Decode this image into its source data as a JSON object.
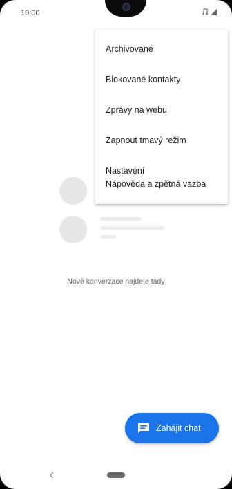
{
  "status_bar": {
    "time": "10:00",
    "icons": [
      "notification-icon",
      "signal-icon",
      "battery-icon"
    ]
  },
  "menu": {
    "items": [
      {
        "label": "Archivované"
      },
      {
        "label": "Blokované kontakty"
      },
      {
        "label": "Zprávy na webu"
      },
      {
        "label": "Zapnout tmavý režim"
      },
      {
        "label": "Nastavení"
      },
      {
        "label": "Nápověda a zpětná vazba"
      }
    ]
  },
  "empty_state": {
    "text": "Nové konverzace najdete tady"
  },
  "fab": {
    "label": "Zahájit chat",
    "icon": "chat-icon",
    "color": "#1a73e8"
  },
  "nav_bar": {
    "icons": [
      "back-icon",
      "home-pill"
    ]
  }
}
